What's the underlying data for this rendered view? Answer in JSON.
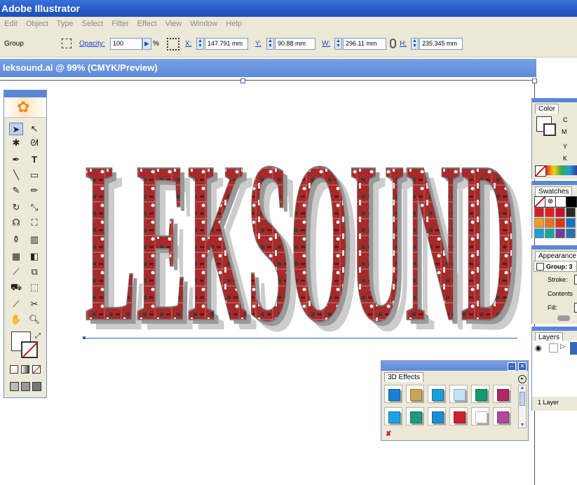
{
  "app": {
    "title": "Adobe Illustrator"
  },
  "menu": [
    "Edit",
    "Object",
    "Type",
    "Select",
    "Filter",
    "Effect",
    "View",
    "Window",
    "Help"
  ],
  "control": {
    "selection_label": "Group",
    "opacity_label": "Opacity:",
    "opacity_value": "100",
    "opacity_unit": "%",
    "x_label": "X:",
    "x_value": "147.791 mm",
    "y_label": "Y:",
    "y_value": "90.88 mm",
    "w_label": "W:",
    "w_value": "296.11 mm",
    "h_label": "H:",
    "h_value": "235.345 mm"
  },
  "document": {
    "tab_title": "leksound.ai @ 99% (CMYK/Preview)"
  },
  "artwork": {
    "text": "LEKSOUND"
  },
  "panels": {
    "color": {
      "tab": "Color",
      "channels": [
        "C",
        "M",
        "Y",
        "K"
      ]
    },
    "swatches": {
      "tab": "Swatches",
      "colors": [
        "#d61b25",
        "#e0201c",
        "#c8102e",
        "#2a2a2a",
        "#f29b1f",
        "#e8711b",
        "#d9351a",
        "#1b6fc4",
        "#1a9fd8",
        "#13a89e",
        "#6c3b96",
        "#2a6fb0"
      ]
    },
    "appearance": {
      "tab": "Appearance",
      "group_label": "Group: 3",
      "stroke_label": "Stroke:",
      "contents_label": "Contents",
      "fill_label": "Fill:"
    },
    "layers": {
      "tab": "Layers",
      "count_label": "1 Layer"
    },
    "effects3d": {
      "tab": "3D Effects",
      "swatch_colors": [
        "#1f7fd0",
        "#c9a45a",
        "#1a9fd8",
        "#bfe3f7",
        "#139a6e",
        "#b0285f",
        "#1aa3e0",
        "#1f9a7a",
        "#1a8fd6",
        "#d0202a",
        "#ffffff",
        "#b0499a"
      ]
    }
  },
  "colors": {
    "title_bar": "#2458c8",
    "doc_bar": "#6a93dc",
    "panel_bg": "#ece9d8",
    "accent": "#1a3fc4"
  }
}
